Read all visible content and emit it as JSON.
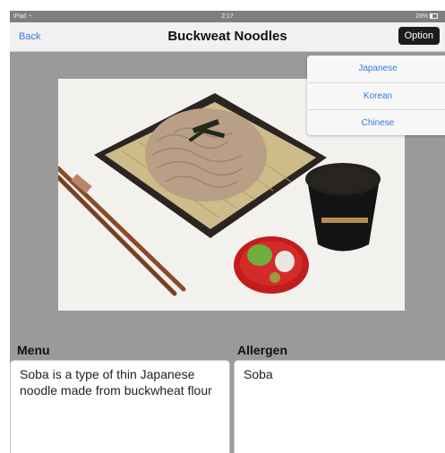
{
  "status_bar": {
    "device": "iPad",
    "time": "2:17",
    "battery": "28%"
  },
  "nav": {
    "back_label": "Back",
    "title": "Buckweat Noodles",
    "option_label": "Option"
  },
  "language_menu": {
    "items": [
      "Japanese",
      "Korean",
      "Chinese"
    ]
  },
  "menu_section": {
    "label": "Menu",
    "text": "Soba is a type of thin Japanese noodle made from buckwheat flour"
  },
  "allergen_section": {
    "label": "Allergen",
    "text": "Soba"
  },
  "colors": {
    "accent": "#2d7be0",
    "background": "#9a9a9a",
    "nav_background": "#f1f1f1"
  }
}
